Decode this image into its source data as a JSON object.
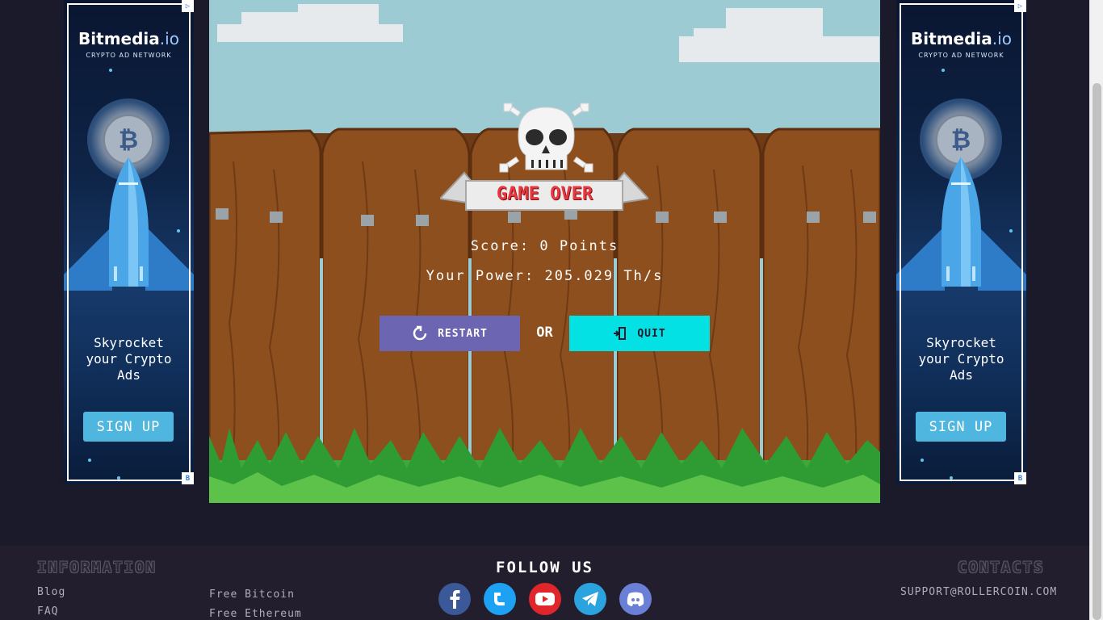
{
  "ads": {
    "left": {
      "brand": "Bitmedia",
      "brand_suffix": ".io",
      "tagline": "CRYPTO AD NETWORK",
      "coin_symbol": "₿",
      "copy_line1": "Skyrocket",
      "copy_line2": "your Crypto",
      "copy_line3": "Ads",
      "cta": "SIGN UP",
      "corner_top": "▷",
      "corner_bottom": "B"
    },
    "right": {
      "brand": "Bitmedia",
      "brand_suffix": ".io",
      "tagline": "CRYPTO AD NETWORK",
      "coin_symbol": "₿",
      "copy_line1": "Skyrocket",
      "copy_line2": "your Crypto",
      "copy_line3": "Ads",
      "cta": "SIGN UP",
      "corner_top": "▷",
      "corner_bottom": "B"
    }
  },
  "game": {
    "banner": "GAME OVER",
    "score": "Score: 0 Points",
    "power": "Your Power: 205.029 Th/s",
    "restart_label": "RESTART",
    "or_label": "OR",
    "quit_label": "QUIT"
  },
  "footer": {
    "information_heading": "INFORMATION",
    "follow_heading": "FOLLOW US",
    "contacts_heading": "CONTACTS",
    "links_col1": [
      "Blog",
      "FAQ"
    ],
    "links_col2": [
      "Free Bitcoin",
      "Free Ethereum"
    ],
    "email": "SUPPORT@ROLLERCOIN.COM",
    "social": [
      "facebook-icon",
      "twitter-icon",
      "youtube-icon",
      "telegram-icon",
      "discord-icon"
    ]
  },
  "colors": {
    "page_bg": "#1b1a2b",
    "restart": "#6c66b2",
    "quit": "#03e1e4",
    "game_over_red": "#e8383f",
    "ad_cta": "#4fb7df"
  }
}
